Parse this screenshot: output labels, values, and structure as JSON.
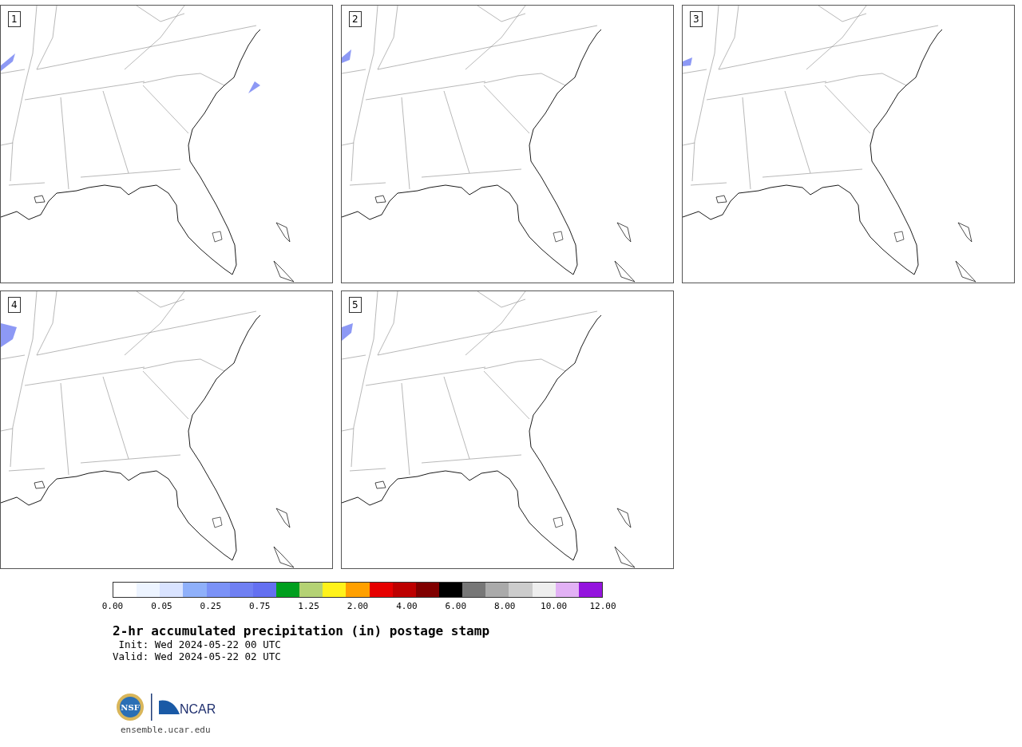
{
  "panels": [
    {
      "number": "1"
    },
    {
      "number": "2"
    },
    {
      "number": "3"
    },
    {
      "number": "4"
    },
    {
      "number": "5"
    }
  ],
  "colorbar": {
    "cells": [
      {
        "color": "#ffffff"
      },
      {
        "color": "#edf4ff"
      },
      {
        "color": "#d9e3ff"
      },
      {
        "color": "#8fb0fa"
      },
      {
        "color": "#7b92f7"
      },
      {
        "color": "#7080f3"
      },
      {
        "color": "#6470f1"
      },
      {
        "color": "#009f1e"
      },
      {
        "color": "#b4d274"
      },
      {
        "color": "#fff21a"
      },
      {
        "color": "#ffa000"
      },
      {
        "color": "#e60000"
      },
      {
        "color": "#bd0000"
      },
      {
        "color": "#800000"
      },
      {
        "color": "#000000"
      },
      {
        "color": "#777777"
      },
      {
        "color": "#aaaaaa"
      },
      {
        "color": "#cccccc"
      },
      {
        "color": "#eeeeee"
      },
      {
        "color": "#e2b1f5"
      },
      {
        "color": "#9414de"
      }
    ],
    "labels": [
      "0.00",
      "0.05",
      "0.25",
      "0.75",
      "1.25",
      "2.00",
      "4.00",
      "6.00",
      "8.00",
      "10.00",
      "12.00"
    ]
  },
  "title": "2-hr accumulated precipitation (in) postage stamp",
  "init": " Init: Wed 2024-05-22 00 UTC",
  "valid": "Valid: Wed 2024-05-22 02 UTC",
  "logo": {
    "nsf": "NSF",
    "ncar": "NCAR"
  },
  "url": "ensemble.ucar.edu"
}
